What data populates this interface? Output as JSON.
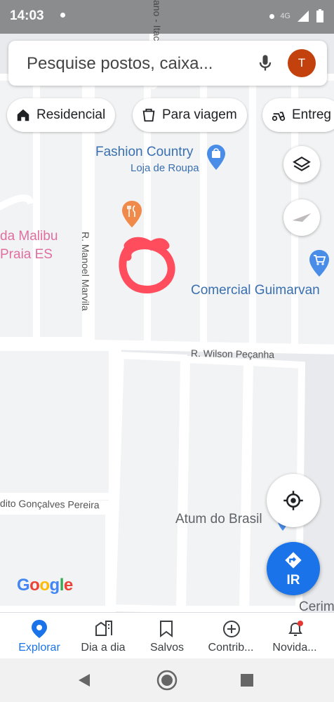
{
  "status_bar": {
    "time": "14:03",
    "network": "4G"
  },
  "search": {
    "placeholder": "Pesquise postos, caixa...",
    "avatar_letter": "T"
  },
  "chips": [
    {
      "label": "Residencial",
      "icon": "home-icon"
    },
    {
      "label": "Para viagem",
      "icon": "takeout-icon"
    },
    {
      "label": "Entreg",
      "icon": "delivery-icon"
    }
  ],
  "map": {
    "places": {
      "fashion_name": "Fashion Country",
      "fashion_category": "Loja de Roupa",
      "malibu_line1": "da Malibu",
      "malibu_line2": "Praia ES",
      "comercial": "Comercial Guimarvan",
      "atum": "Atum do Brasil",
      "cerim": "Cerim"
    },
    "streets": {
      "manoel": "R. Manoel Marvila",
      "wilson": "R. Wilson Peçanha",
      "goncalves": "dito Gonçalves Pereira",
      "ita": "ano - Itac"
    },
    "go_button": "IR",
    "attribution": "Google",
    "colors": {
      "accent": "#1a73e8",
      "annotation": "#ff4d5e"
    }
  },
  "bottom_nav": [
    {
      "label": "Explorar",
      "icon": "explore-pin-icon",
      "active": true
    },
    {
      "label": "Dia a dia",
      "icon": "commute-icon",
      "active": false
    },
    {
      "label": "Salvos",
      "icon": "bookmark-icon",
      "active": false
    },
    {
      "label": "Contrib...",
      "icon": "add-circle-icon",
      "active": false
    },
    {
      "label": "Novida...",
      "icon": "bell-icon",
      "active": false
    }
  ]
}
